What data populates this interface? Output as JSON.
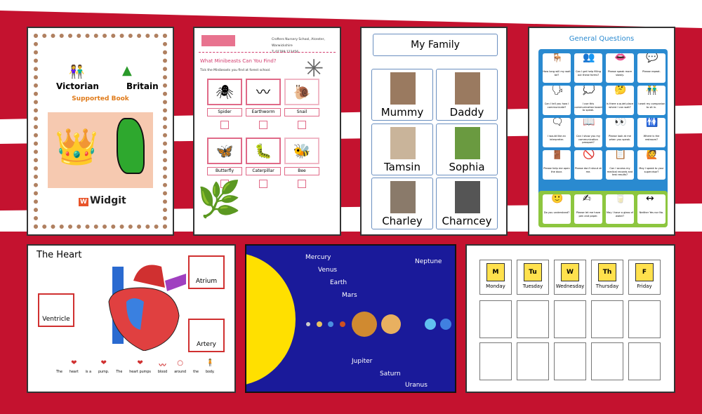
{
  "colors": {
    "stripe": "#c4122f",
    "accent_blue": "#2a8ad0",
    "accent_green": "#8dc63f",
    "space": "#1a1a9a",
    "sun": "#ffe000"
  },
  "victorian": {
    "title_left": "Victorian",
    "title_right": "Britain",
    "subtitle": "Supported Book",
    "logo": "Widgit"
  },
  "minibeasts": {
    "address": "Crofters Nursery School, Alcester, Warwickshire",
    "phone": "T: 01789 123456",
    "heading": "What Minibeasts Can You Find?",
    "instruction": "Tick the Minibeasts you find at forest school.",
    "items": [
      {
        "label": "Spider",
        "icon": "🕷"
      },
      {
        "label": "Earthworm",
        "icon": "〰"
      },
      {
        "label": "Snail",
        "icon": "🐌"
      },
      {
        "label": "Butterfly",
        "icon": "🦋"
      },
      {
        "label": "Caterpillar",
        "icon": "🐛"
      },
      {
        "label": "Bee",
        "icon": "🐝"
      }
    ]
  },
  "family": {
    "title": "My Family",
    "members": [
      "Mummy",
      "Daddy",
      "Tamsin",
      "Sophia",
      "Charley",
      "Charncey"
    ]
  },
  "questions": {
    "title": "General Questions",
    "items": [
      "How long will my wait be?",
      "Can I get help filling out these forms?",
      "Please speak more slowly.",
      "Please repeat.",
      "Can I tell you how I communicate?",
      "I use this communication board to speak.",
      "Is there a quiet place where I can wait?",
      "I want my companion to sit in.",
      "I would like an interpreter.",
      "Can I show you my communication passport?",
      "Please look at me when you speak.",
      "Where is the restroom?",
      "Please help me open the door.",
      "Please don't shout at me.",
      "Can I access my medical records and test results?",
      "May I speak to your supervisor?"
    ],
    "green_items": [
      "Do you understand?",
      "Please let me have pen and paper.",
      "May I have a glass of water?",
      "Neither Yes nor No."
    ]
  },
  "heart": {
    "title": "The Heart",
    "labels": {
      "atrium": "Atrium",
      "ventricle": "Ventricle",
      "artery": "Artery"
    },
    "sentence": [
      "The",
      "heart",
      "is a",
      "pump.",
      "The",
      "heart pumps",
      "blood",
      "around",
      "the",
      "body."
    ]
  },
  "planets": {
    "labels": [
      "Mercury",
      "Venus",
      "Earth",
      "Mars",
      "Jupiter",
      "Saturn",
      "Uranus",
      "Neptune"
    ]
  },
  "week": {
    "days": [
      {
        "letter": "M",
        "name": "Monday"
      },
      {
        "letter": "Tu",
        "name": "Tuesday"
      },
      {
        "letter": "W",
        "name": "Wednesday"
      },
      {
        "letter": "Th",
        "name": "Thursday"
      },
      {
        "letter": "F",
        "name": "Friday"
      }
    ]
  }
}
